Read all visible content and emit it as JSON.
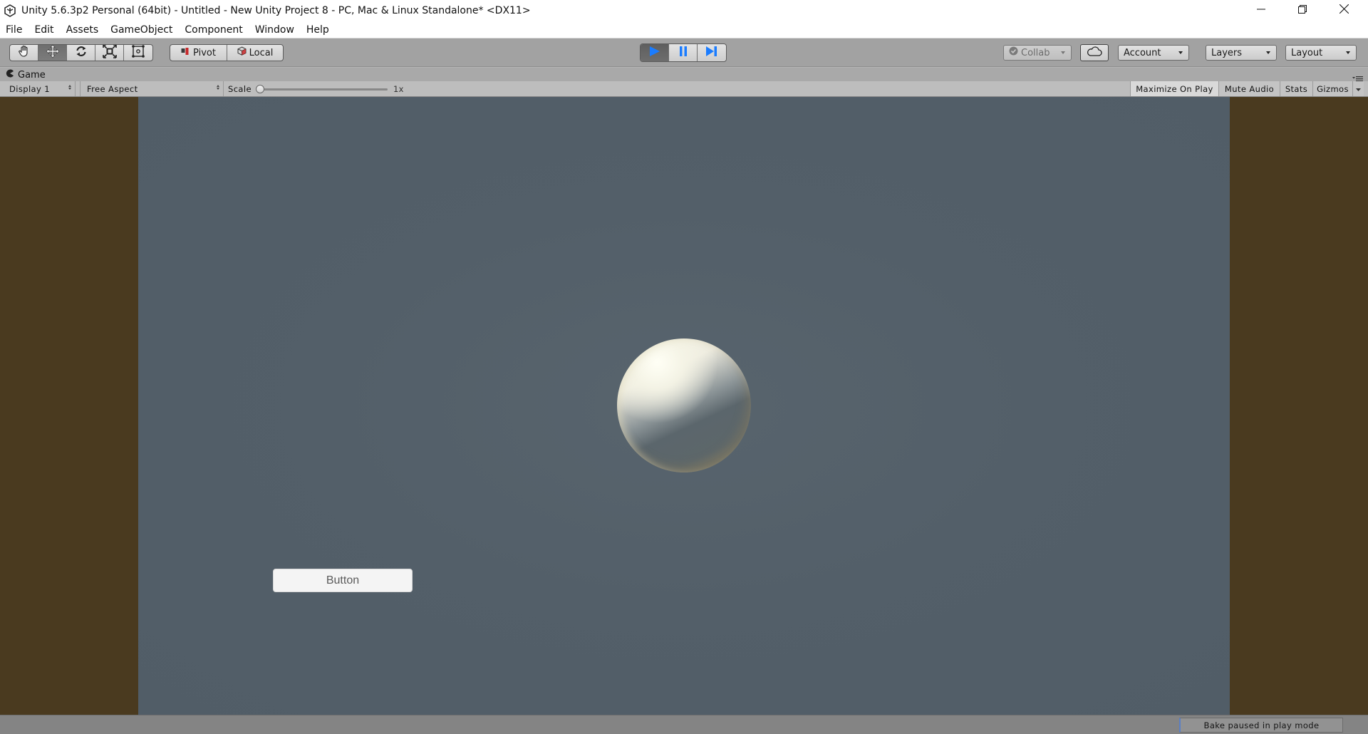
{
  "window": {
    "title": "Unity 5.6.3p2 Personal (64bit) - Untitled - New Unity Project 8 - PC, Mac & Linux Standalone* <DX11>",
    "app_icon": "unity-logo-icon",
    "controls": [
      "minimize-icon",
      "restore-icon",
      "close-icon"
    ]
  },
  "menubar": {
    "items": [
      "File",
      "Edit",
      "Assets",
      "GameObject",
      "Component",
      "Window",
      "Help"
    ]
  },
  "toolbar": {
    "transform_tools": [
      {
        "name": "hand-tool",
        "icon": "hand-icon",
        "active": false
      },
      {
        "name": "move-tool",
        "icon": "move-arrows-icon",
        "active": true
      },
      {
        "name": "rotate-tool",
        "icon": "rotate-icon",
        "active": false
      },
      {
        "name": "scale-tool",
        "icon": "scale-icon",
        "active": false
      },
      {
        "name": "rect-tool",
        "icon": "rect-transform-icon",
        "active": false
      }
    ],
    "pivot_label": "Pivot",
    "local_label": "Local",
    "playback": {
      "play_active": true,
      "pause_active": false,
      "step_active": false,
      "accent": "#1a7cff"
    },
    "collab_label": "Collab",
    "account_label": "Account",
    "layers_label": "Layers",
    "layout_label": "Layout"
  },
  "game_panel": {
    "tab_label": "Game",
    "display_select": "Display 1",
    "aspect_select": "Free Aspect",
    "scale_label": "Scale",
    "scale_value": "1x",
    "scale_fraction": 0.0,
    "maximize_on_play": "Maximize On Play",
    "mute_audio": "Mute Audio",
    "stats": "Stats",
    "gizmos": "Gizmos",
    "maximize_on_play_active": true
  },
  "game_view": {
    "letterbox_color": "#4a3a1f",
    "background_color": "#535f69",
    "ui_button_label": "Button"
  },
  "statusbar": {
    "bake_status": "Bake paused in play mode"
  }
}
